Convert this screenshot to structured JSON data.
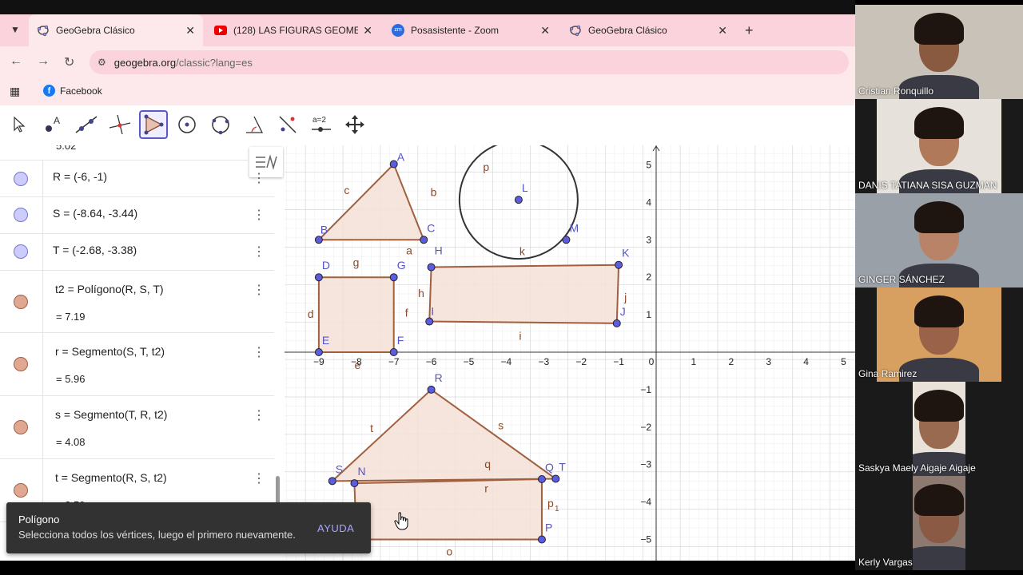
{
  "browser": {
    "tabs": [
      {
        "label": "GeoGebra Clásico",
        "icon": "geogebra-icon",
        "active": true
      },
      {
        "label": "(128) LAS FIGURAS GEOMETRICAS",
        "icon": "youtube-icon",
        "active": false
      },
      {
        "label": "Posasistente - Zoom",
        "icon": "zoom-icon",
        "active": false
      },
      {
        "label": "GeoGebra Clásico",
        "icon": "geogebra-icon",
        "active": false
      }
    ],
    "url_host": "geogebra.org",
    "url_path": "/classic?lang=es",
    "bookmark": "Facebook",
    "zoom_icon_text": "zm"
  },
  "toolbar": {
    "tools": [
      "move-tool",
      "point-tool",
      "line-tool",
      "perpendicular-tool",
      "polygon-tool",
      "circle-tool",
      "conic-tool",
      "angle-tool",
      "reflect-tool",
      "slider-tool",
      "move-view-tool"
    ],
    "slider_text": "a=2"
  },
  "algebra": {
    "partial_value": "5.02",
    "rows": [
      {
        "def": "R = (-6, -1)",
        "value": ""
      },
      {
        "def": "S = (-8.64, -3.44)",
        "value": ""
      },
      {
        "def": "T = (-2.68, -3.38)",
        "value": ""
      },
      {
        "def": "t2 = Polígono(R, S, T)",
        "value": "= 7.19"
      },
      {
        "def": "r = Segmento(S, T, t2)",
        "value": "= 5.96"
      },
      {
        "def": "s = Segmento(T, R, t2)",
        "value": "= 4.08"
      },
      {
        "def": "t = Segmento(R, S, t2)",
        "value": "= 3.59"
      }
    ],
    "point_color": "#ccccff",
    "poly_color": "#e0a890"
  },
  "graphics": {
    "x_ticks": [
      "−9",
      "−8",
      "−7",
      "−6",
      "−5",
      "−4",
      "−3",
      "−2",
      "−1",
      "0",
      "1",
      "2",
      "3",
      "4",
      "5"
    ],
    "y_ticks": [
      "5",
      "4",
      "3",
      "2",
      "1",
      "−1",
      "−2",
      "−3",
      "−4",
      "−5"
    ],
    "labels": {
      "A": "A",
      "B": "B",
      "C": "C",
      "D": "D",
      "E": "E",
      "F": "F",
      "G": "G",
      "H": "H",
      "I": "I",
      "J": "J",
      "K": "K",
      "L": "L",
      "M": "M",
      "R": "R",
      "S": "S",
      "N": "N",
      "Q": "Q",
      "T": "T",
      "P": "P",
      "a": "a",
      "b": "b",
      "c": "c",
      "d": "d",
      "e": "e",
      "f": "f",
      "g": "g",
      "h": "h",
      "i": "i",
      "j": "j",
      "k": "k",
      "p": "p",
      "q": "q",
      "r": "r",
      "s": "s",
      "t": "t",
      "o": "o",
      "p1": "p",
      "p1sub": "1"
    }
  },
  "tooltip": {
    "title": "Polígono",
    "text": "Selecciona todos los vértices, luego el primero nuevamente.",
    "action": "AYUDA"
  },
  "participants": [
    {
      "name": "Cristian Ronquillo",
      "skin": "#8a5a40",
      "bg": "#c9c2b8"
    },
    {
      "name": "DANIS TATIANA SISA GUZMAN",
      "skin": "#b07a5a",
      "bg": "#e6e1da"
    },
    {
      "name": "GINGER SÁNCHEZ",
      "skin": "#b88366",
      "bg": "#9aa0a8"
    },
    {
      "name": "Gina Ramirez",
      "skin": "#9a6248",
      "bg": "#d8a060"
    },
    {
      "name": "Saskya Maely Aigaje Aigaje",
      "skin": "#9a6a50",
      "bg": "#e8e2d8"
    },
    {
      "name": "Kerly Vargas",
      "skin": "#8a5a44",
      "bg": "#8c7a70"
    }
  ]
}
